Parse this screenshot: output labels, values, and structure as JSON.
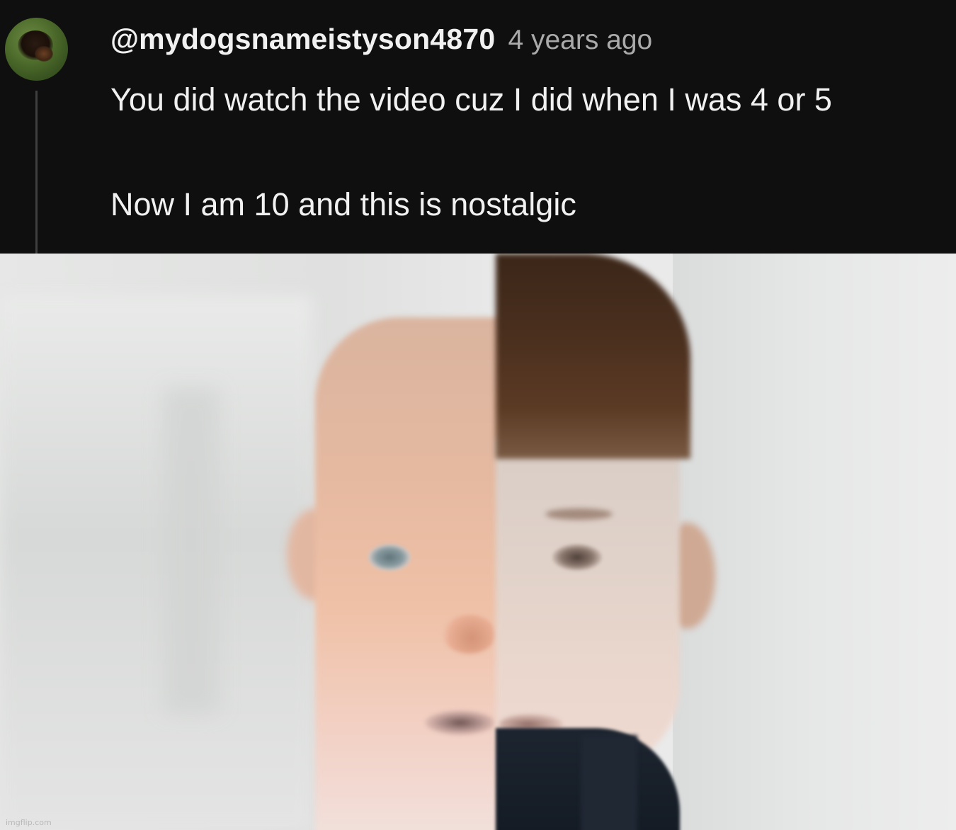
{
  "comment": {
    "author": "@mydogsnameistyson4870",
    "timestamp": "4 years ago",
    "text_line_1": "You did watch the video cuz I did when I was 4 or 5",
    "text_line_2": "Now I am 10 and this is nostalgic",
    "avatar_icon": "dog-avatar-icon"
  },
  "image": {
    "watermark": "imgflip.com"
  }
}
